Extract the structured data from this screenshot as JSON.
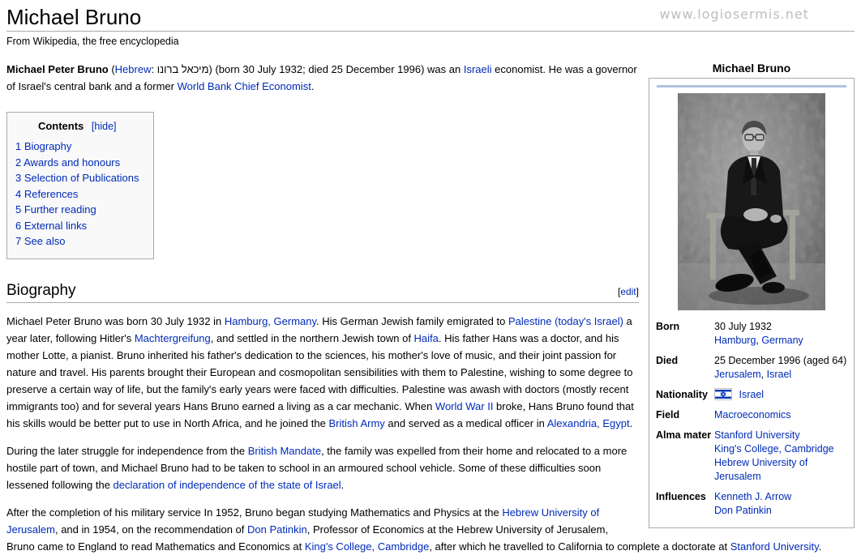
{
  "watermark": "www.logiosermis.net",
  "page": {
    "title": "Michael Bruno",
    "tagline": "From Wikipedia, the free encyclopedia"
  },
  "colors": {
    "link_blue": "#002bb8",
    "infobox_bar": "#aec3de",
    "flag_blue": "#0038b8",
    "box_border": "#aaaaaa",
    "toc_background": "#f9f9f9",
    "watermark_gray": "#bdbdbd"
  },
  "intro": {
    "segments": [
      {
        "t": "Michael Peter Bruno",
        "b": true
      },
      {
        "t": " ("
      },
      {
        "t": "Hebrew",
        "link": true
      },
      {
        "t": ": מיכאל ברונו‎) (born 30 July 1932; died 25 December 1996) was an "
      },
      {
        "t": "Israeli",
        "link": true
      },
      {
        "t": " economist. He was a governor of Israel's central bank and a former "
      },
      {
        "t": "World Bank Chief Economist",
        "link": true
      },
      {
        "t": "."
      }
    ]
  },
  "toc": {
    "title": "Contents",
    "toggle_label": "[hide]",
    "items": [
      "1 Biography",
      "2 Awards and honours",
      "3 Selection of Publications",
      "4 References",
      "5 Further reading",
      "6 External links",
      "7 See also"
    ]
  },
  "biography": {
    "heading": "Biography",
    "edit_open": "[",
    "edit_label": "edit",
    "edit_close": "]",
    "paragraphs": [
      [
        {
          "t": "Michael Peter Bruno was born 30 July 1932 in "
        },
        {
          "t": "Hamburg, Germany",
          "link": true
        },
        {
          "t": ". His German Jewish family emigrated to "
        },
        {
          "t": "Palestine (today's Israel)",
          "link": true
        },
        {
          "t": " a year later, following Hitler's "
        },
        {
          "t": "Machtergreifung",
          "link": true
        },
        {
          "t": ", and settled in the northern Jewish town of "
        },
        {
          "t": "Haifa",
          "link": true
        },
        {
          "t": ". His father Hans was a doctor, and his mother Lotte, a pianist. Bruno inherited his father's dedication to the sciences, his mother's love of music, and their joint passion for nature and travel. His parents brought their European and cosmopolitan sensibilities with them to Palestine, wishing to some degree to preserve a certain way of life, but the family's early years were faced with difficulties. Palestine was awash with doctors (mostly recent immigrants too) and for several years Hans Bruno earned a living as a car mechanic. When "
        },
        {
          "t": "World War II",
          "link": true
        },
        {
          "t": " broke, Hans Bruno found that his skills would be better put to use in North Africa, and he joined the "
        },
        {
          "t": "British Army",
          "link": true
        },
        {
          "t": " and served as a medical officer in "
        },
        {
          "t": "Alexandria, Egypt",
          "link": true
        },
        {
          "t": "."
        }
      ],
      [
        {
          "t": "During the later struggle for independence from the "
        },
        {
          "t": "British Mandate",
          "link": true
        },
        {
          "t": ", the family was expelled from their home and relocated to a more hostile part of town, and Michael Bruno had to be taken to school in an armoured school vehicle. Some of these difficulties soon lessened following the "
        },
        {
          "t": "declaration of independence of the state of Israel",
          "link": true
        },
        {
          "t": "."
        }
      ],
      [
        {
          "t": "After the completion of his military service In 1952, Bruno began studying Mathematics and Physics at the "
        },
        {
          "t": "Hebrew University of Jerusalem",
          "link": true
        },
        {
          "t": ", and in 1954, on the recommendation of "
        },
        {
          "t": "Don Patinkin",
          "link": true
        },
        {
          "t": ", Professor of Economics at the Hebrew University of Jerusalem, Bruno came to England to read Mathematics and Economics at "
        },
        {
          "t": "King's College, Cambridge",
          "link": true
        },
        {
          "t": ", after which he travelled to California to complete a doctorate at "
        },
        {
          "t": "Stanford University",
          "link": true
        },
        {
          "t": "."
        }
      ]
    ]
  },
  "infobox": {
    "title": "Michael Bruno",
    "photo_description": "Black-and-white portrait of Michael Bruno seated in a chair wearing glasses and a dark suit",
    "rows": [
      {
        "label": "Born",
        "lines": [
          [
            {
              "t": "30 July 1932"
            }
          ],
          [
            {
              "t": "Hamburg",
              "link": true
            },
            {
              "t": ", "
            },
            {
              "t": "Germany",
              "link": true
            }
          ]
        ]
      },
      {
        "label": "Died",
        "lines": [
          [
            {
              "t": "25 December 1996 (aged 64)"
            }
          ],
          [
            {
              "t": "Jerusalem",
              "link": true
            },
            {
              "t": ", "
            },
            {
              "t": "Israel",
              "link": true
            }
          ]
        ]
      },
      {
        "label": "Nationality",
        "flag": "israel-flag",
        "lines": [
          [
            {
              "t": "Israel",
              "link": true
            }
          ]
        ]
      },
      {
        "label": "Field",
        "lines": [
          [
            {
              "t": "Macroeconomics",
              "link": true
            }
          ]
        ]
      },
      {
        "label": "Alma mater",
        "lines": [
          [
            {
              "t": "Stanford University",
              "link": true
            }
          ],
          [
            {
              "t": "King's College, Cambridge",
              "link": true
            }
          ],
          [
            {
              "t": "Hebrew University of Jerusalem",
              "link": true
            }
          ]
        ]
      },
      {
        "label": "Influences",
        "lines": [
          [
            {
              "t": "Kenneth J. Arrow",
              "link": true
            }
          ],
          [
            {
              "t": "Don Patinkin",
              "link": true
            }
          ]
        ]
      }
    ]
  }
}
